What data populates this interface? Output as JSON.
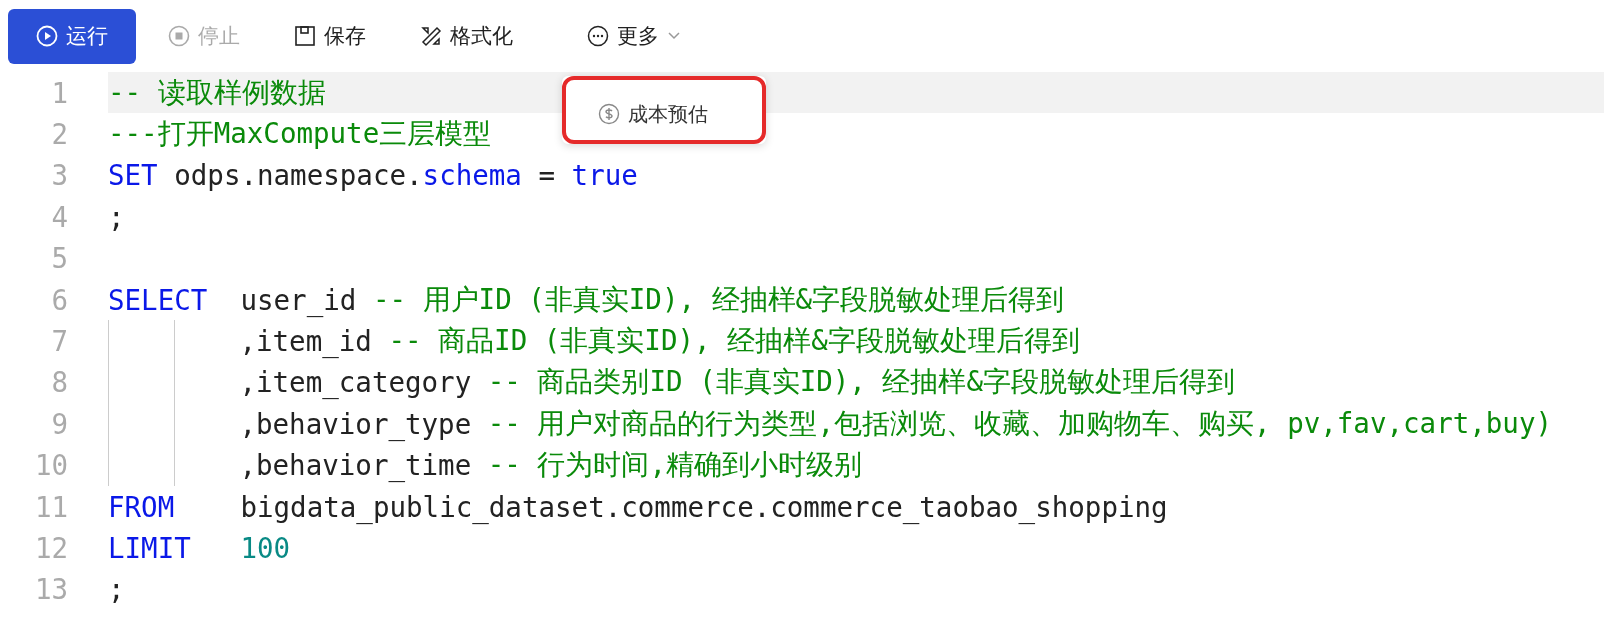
{
  "toolbar": [
    {
      "kind": "run",
      "label": "运行",
      "disabled": false
    },
    {
      "kind": "stop",
      "label": "停止",
      "disabled": true
    },
    {
      "kind": "save",
      "label": "保存",
      "disabled": false
    },
    {
      "kind": "format",
      "label": "格式化",
      "disabled": false
    },
    {
      "kind": "more",
      "label": "更多",
      "disabled": false
    }
  ],
  "dropdown": {
    "items": [
      {
        "kind": "cost",
        "label": "成本预估",
        "highlighted": true
      }
    ]
  },
  "editor": {
    "lines": [
      {
        "number": "1",
        "current": true,
        "continued": false,
        "tokens": [
          {
            "kind": "comment",
            "text": "-- 读取样例数据"
          }
        ]
      },
      {
        "number": "2",
        "current": false,
        "continued": false,
        "tokens": [
          {
            "kind": "comment",
            "text": "---打开MaxCompute三层模型"
          }
        ]
      },
      {
        "number": "3",
        "current": false,
        "continued": false,
        "tokens": [
          {
            "kind": "keyword",
            "text": "SET"
          },
          {
            "kind": "plain",
            "text": " odps.namespace."
          },
          {
            "kind": "keyword",
            "text": "schema"
          },
          {
            "kind": "plain",
            "text": " = "
          },
          {
            "kind": "keyword",
            "text": "true"
          }
        ]
      },
      {
        "number": "4",
        "current": false,
        "continued": false,
        "tokens": [
          {
            "kind": "plain",
            "text": ";"
          }
        ]
      },
      {
        "number": "5",
        "current": false,
        "continued": false
      },
      {
        "number": "6",
        "current": false,
        "continued": false,
        "tokens": [
          {
            "kind": "keyword",
            "text": "SELECT  "
          },
          {
            "kind": "plain",
            "text": "user_id "
          },
          {
            "kind": "comment",
            "text": "-- 用户ID (非真实ID), 经抽样&字段脱敏处理后得到"
          }
        ]
      },
      {
        "number": "7",
        "current": false,
        "continued": true,
        "tokens": [
          {
            "kind": "plain",
            "text": ",item_id "
          },
          {
            "kind": "comment",
            "text": "-- 商品ID (非真实ID), 经抽样&字段脱敏处理后得到"
          }
        ]
      },
      {
        "number": "8",
        "current": false,
        "continued": true,
        "tokens": [
          {
            "kind": "plain",
            "text": ",item_category "
          },
          {
            "kind": "comment",
            "text": "-- 商品类别ID (非真实ID), 经抽样&字段脱敏处理后得到"
          }
        ]
      },
      {
        "number": "9",
        "current": false,
        "continued": true,
        "tokens": [
          {
            "kind": "plain",
            "text": ",behavior_type "
          },
          {
            "kind": "comment",
            "text": "-- 用户对商品的行为类型,包括浏览、收藏、加购物车、购买, pv,fav,cart,buy)"
          }
        ]
      },
      {
        "number": "10",
        "current": false,
        "continued": true,
        "tokens": [
          {
            "kind": "plain",
            "text": ",behavior_time "
          },
          {
            "kind": "comment",
            "text": "-- 行为时间,精确到小时级别"
          }
        ]
      },
      {
        "number": "11",
        "current": false,
        "continued": false,
        "tokens": [
          {
            "kind": "keyword",
            "text": "FROM    "
          },
          {
            "kind": "plain",
            "text": "bigdata_public_dataset.commerce.commerce_taobao_shopping"
          }
        ]
      },
      {
        "number": "12",
        "current": false,
        "continued": false,
        "tokens": [
          {
            "kind": "keyword",
            "text": "LIMIT   "
          },
          {
            "kind": "number",
            "text": "100"
          }
        ]
      },
      {
        "number": "13",
        "current": false,
        "continued": false,
        "tokens": [
          {
            "kind": "plain",
            "text": ";"
          }
        ]
      }
    ]
  }
}
